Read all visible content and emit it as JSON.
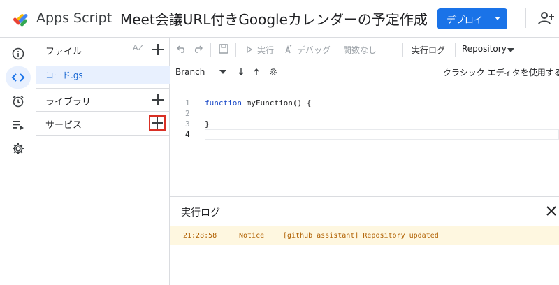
{
  "header": {
    "app_name": "Apps Script",
    "project_title": "Meet会議URL付きGoogleカレンダーの予定作成",
    "deploy_label": "デプロイ"
  },
  "rail": {
    "items": [
      {
        "name": "overview",
        "icon": "info-icon"
      },
      {
        "name": "editor",
        "icon": "code-icon",
        "active": true
      },
      {
        "name": "triggers",
        "icon": "alarm-icon"
      },
      {
        "name": "executions",
        "icon": "list-play-icon"
      },
      {
        "name": "settings",
        "icon": "gear-icon"
      }
    ]
  },
  "files_panel": {
    "files_label": "ファイル",
    "sort_label": "AZ",
    "file_name": "コード.gs",
    "libraries_label": "ライブラリ",
    "services_label": "サービス"
  },
  "toolbar": {
    "run_label": "実行",
    "debug_label": "デバッグ",
    "function_label": "関数なし",
    "log_label": "実行ログ",
    "repository_label": "Repository"
  },
  "subbar": {
    "branch_label": "Branch",
    "classic_label": "クラシック エディタを使用する"
  },
  "editor": {
    "line_numbers": [
      "1",
      "2",
      "3",
      "4"
    ],
    "line1_keyword": "function",
    "line1_rest": " myFunction() {",
    "line3": "}"
  },
  "log": {
    "title": "実行ログ",
    "entry": {
      "time": "21:28:58",
      "level": "Notice",
      "message": "[github assistant] Repository updated"
    }
  },
  "colors": {
    "accent": "#1a73e8",
    "highlight_box": "#d93025",
    "log_notice_bg": "#fef7e0"
  }
}
